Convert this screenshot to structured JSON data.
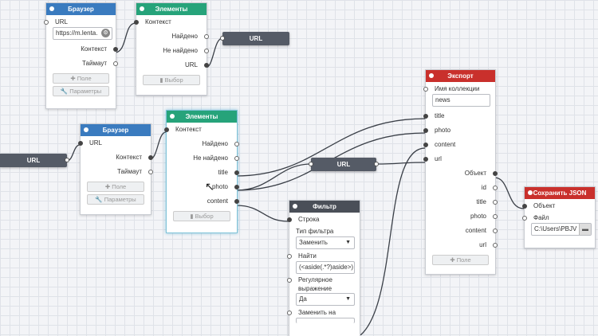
{
  "node_browser1": {
    "title": "Браузер",
    "url_label": "URL",
    "url_value": "https://m.lenta.",
    "context": "Контекст",
    "timeout": "Таймаут",
    "field_btn": "✚ Поле",
    "params_btn": "🔧 Параметры"
  },
  "node_elements1": {
    "title": "Элементы",
    "context": "Контекст",
    "found": "Найдено",
    "not_found": "Не найдено",
    "url": "URL",
    "select_btn": "▮ Выбор"
  },
  "url_node_top": "URL",
  "node_browser2": {
    "title": "Браузер",
    "url_label": "URL",
    "context": "Контекст",
    "timeout": "Таймаут",
    "field_btn": "✚ Поле",
    "params_btn": "🔧 Параметры"
  },
  "url_node_left": "URL",
  "node_elements2": {
    "title": "Элементы",
    "context": "Контекст",
    "found": "Найдено",
    "not_found": "Не найдено",
    "title_out": "title",
    "photo_out": "photo",
    "content_out": "content",
    "select_btn": "▮ Выбор"
  },
  "url_node_mid": "URL",
  "node_filter": {
    "title": "Фильтр",
    "string": "Строка",
    "filter_type_label": "Тип фильтра",
    "filter_type_value": "Заменить",
    "find_label": "Найти",
    "find_value": "(<aside(.*?)aside>)",
    "regex_label1": "Регулярное",
    "regex_label2": "выражение",
    "regex_value": "Да",
    "replace_label": "Заменить на"
  },
  "node_export": {
    "title": "Экспорт",
    "collection_label": "Имя коллекции",
    "collection_value": "news",
    "in_title": "title",
    "in_photo": "photo",
    "in_content": "content",
    "in_url": "url",
    "object": "Объект",
    "out_id": "id",
    "out_title": "title",
    "out_photo": "photo",
    "out_content": "content",
    "out_url": "url",
    "field_btn": "✚ Поле"
  },
  "node_savejson": {
    "title": "Сохранить JSON",
    "object": "Объект",
    "file_label": "Файл",
    "file_value": "C:\\Users\\PBJV"
  }
}
